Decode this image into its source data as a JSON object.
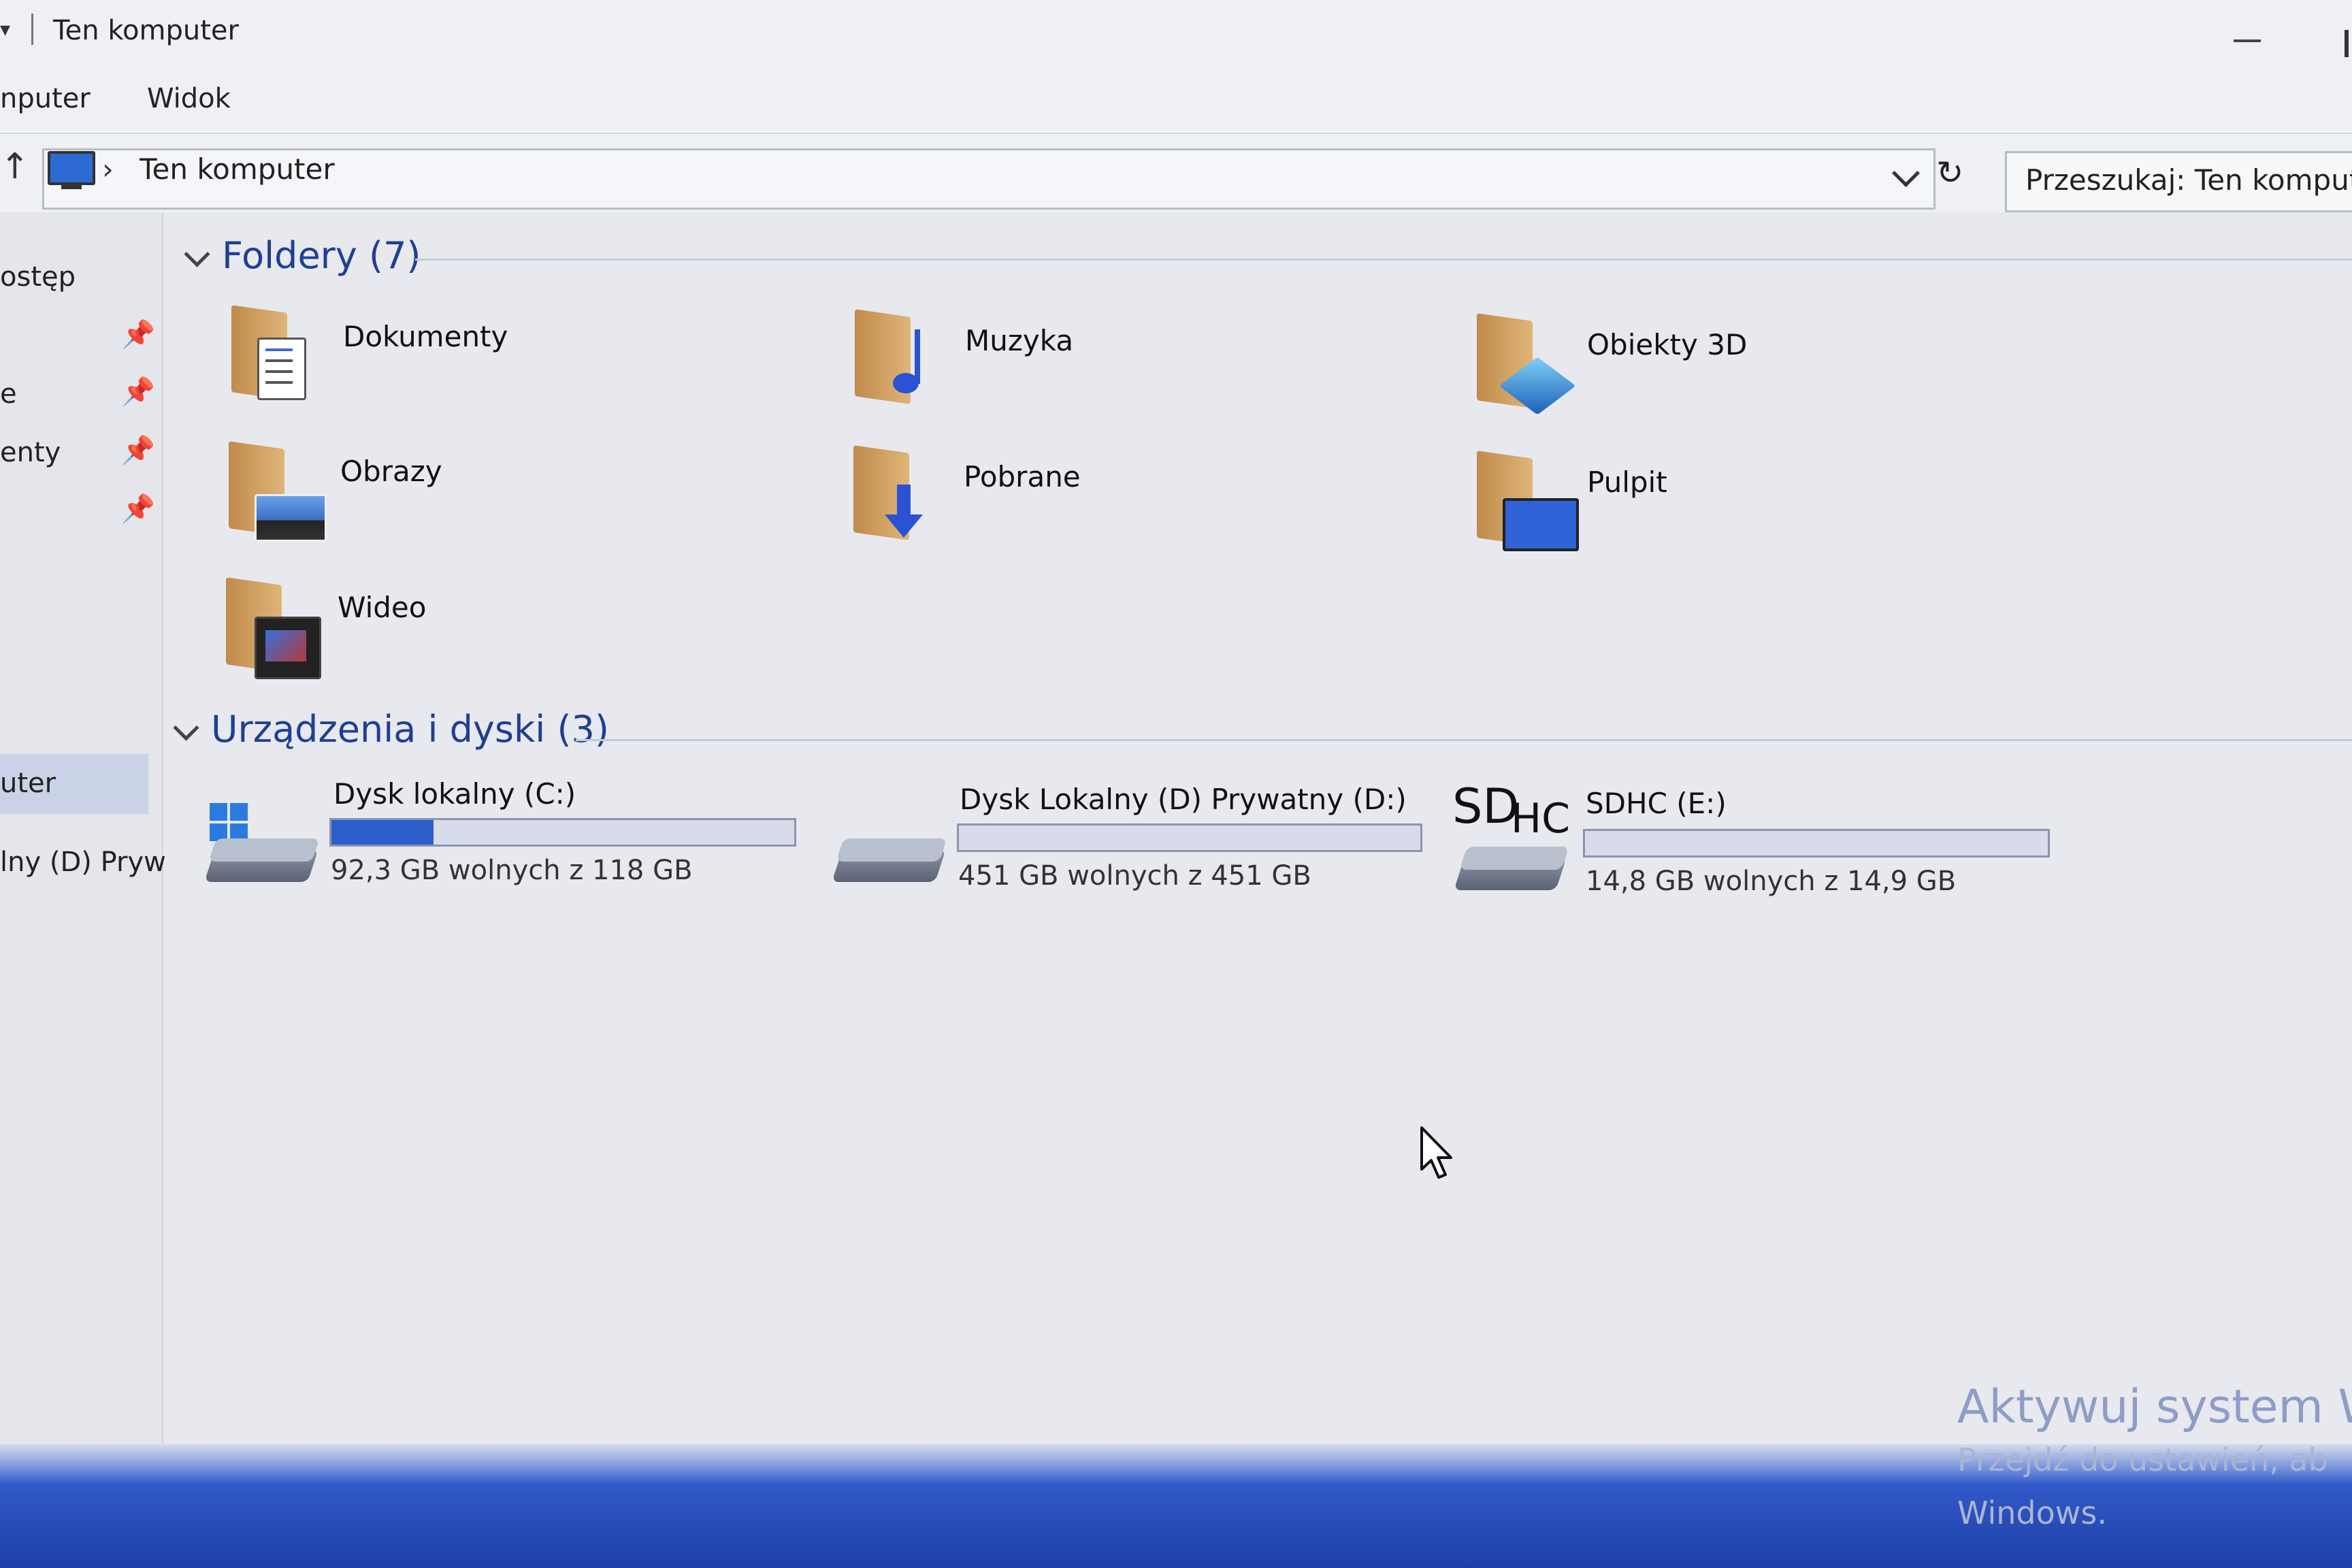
{
  "window": {
    "title": "Ten komputer"
  },
  "ribbon": {
    "tabs": [
      "nputer",
      "Widok"
    ]
  },
  "address": {
    "path": [
      "Ten komputer"
    ],
    "search_placeholder": "Przeszukaj: Ten komputer"
  },
  "nav": {
    "items": [
      {
        "label": "ostęp",
        "pinned": false
      },
      {
        "label": "",
        "pinned": true
      },
      {
        "label": "e",
        "pinned": true
      },
      {
        "label": "enty",
        "pinned": true
      },
      {
        "label": "",
        "pinned": true
      },
      {
        "label": "uter",
        "selected": true
      },
      {
        "label": "lny (D) Pryw"
      }
    ]
  },
  "folders": {
    "header": "Foldery (7)",
    "items": [
      {
        "label": "Dokumenty",
        "icon": "documents-folder-icon"
      },
      {
        "label": "Muzyka",
        "icon": "music-folder-icon"
      },
      {
        "label": "Obiekty 3D",
        "icon": "3d-objects-folder-icon"
      },
      {
        "label": "Obrazy",
        "icon": "pictures-folder-icon"
      },
      {
        "label": "Pobrane",
        "icon": "downloads-folder-icon"
      },
      {
        "label": "Pulpit",
        "icon": "desktop-folder-icon"
      },
      {
        "label": "Wideo",
        "icon": "videos-folder-icon"
      }
    ]
  },
  "devices": {
    "header": "Urządzenia i dyski (3)",
    "items": [
      {
        "label": "Dysk lokalny (C:)",
        "free": "92,3 GB wolnych z 118 GB",
        "used_fraction": 0.22,
        "icon": "windows-drive-icon"
      },
      {
        "label": "Dysk Lokalny (D) Prywatny (D:)",
        "free": "451 GB wolnych z 451 GB",
        "used_fraction": 0.0,
        "icon": "hard-drive-icon"
      },
      {
        "label": "SDHC (E:)",
        "free": "14,8 GB wolnych z 14,9 GB",
        "used_fraction": 0.0,
        "icon": "sdhc-card-icon",
        "icon_text_a": "SD",
        "icon_text_b": "HC"
      }
    ]
  },
  "watermark": {
    "line1": "Aktywuj system W",
    "line2": "Przejdź do ustawień, ab",
    "line3": "Windows."
  },
  "colors": {
    "accent": "#2c5fc9",
    "group_header": "#1f3f93",
    "taskbar": "#2a4fc0"
  }
}
